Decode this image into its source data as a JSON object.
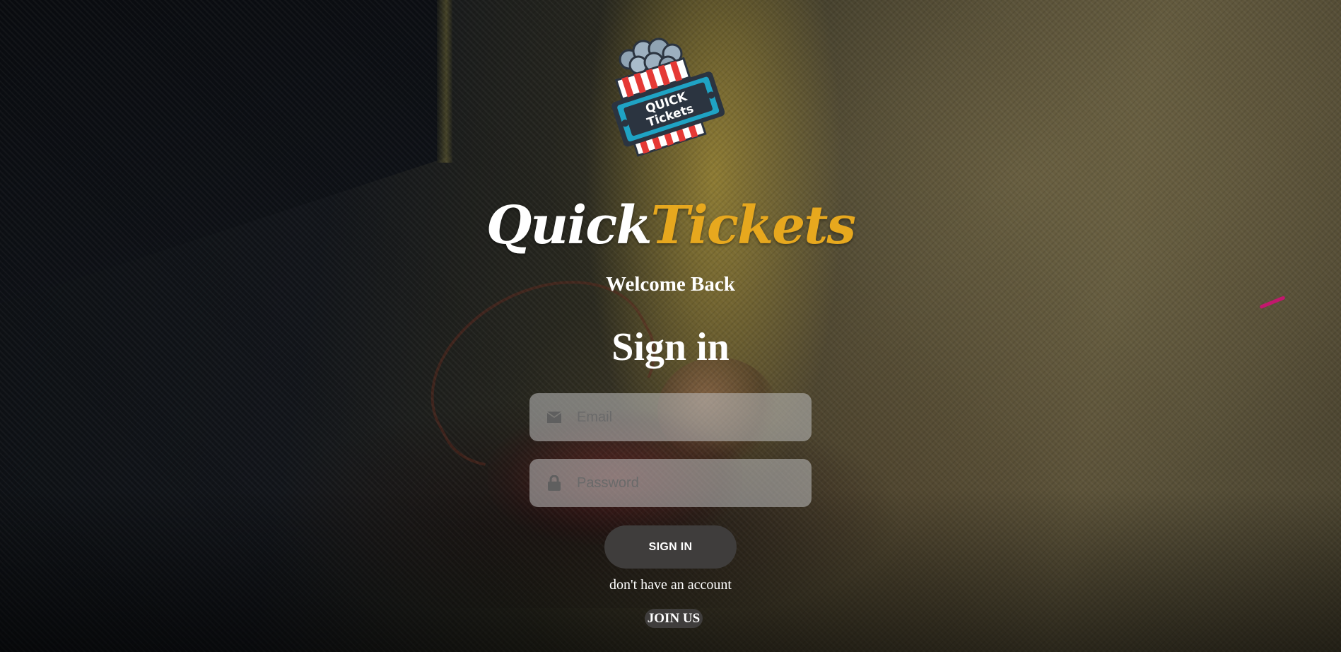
{
  "logo": {
    "badge_line1": "QUICK",
    "badge_line2": "Tickets"
  },
  "brand": {
    "part1": "Quick",
    "part2": "Tickets",
    "color_primary": "#ffffff",
    "color_accent": "#e7a81e"
  },
  "welcome_text": "Welcome Back",
  "form": {
    "title": "Sign in",
    "email": {
      "placeholder": "Email",
      "value": "",
      "icon": "envelope-icon"
    },
    "password": {
      "placeholder": "Password",
      "value": "",
      "icon": "lock-icon"
    },
    "submit_label": "SIGN IN"
  },
  "no_account_text": "don't have an account",
  "join_label": "JOIN US"
}
